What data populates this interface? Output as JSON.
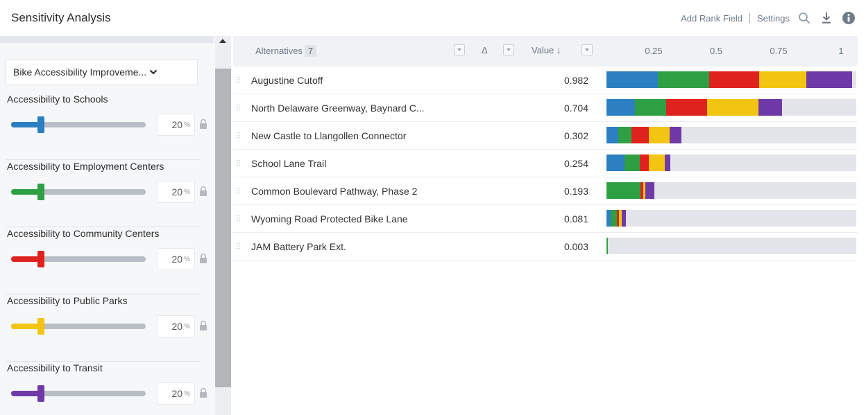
{
  "header": {
    "title": "Sensitivity Analysis",
    "add_rank_field": "Add Rank Field",
    "settings": "Settings",
    "icons": [
      "search-icon",
      "download-icon",
      "info-icon"
    ]
  },
  "sidebar": {
    "goal_dropdown": "Bike Accessibility Improveme...",
    "unit": "%",
    "criteria": [
      {
        "label": "Accessibility to Schools",
        "percent": "20",
        "weight": 0.2,
        "color": "#2c7fc0"
      },
      {
        "label": "Accessibility to Employment Centers",
        "percent": "20",
        "weight": 0.2,
        "color": "#2ea043"
      },
      {
        "label": "Accessibility to Community Centers",
        "percent": "20",
        "weight": 0.2,
        "color": "#e0221f"
      },
      {
        "label": "Accessibility to Public Parks",
        "percent": "20",
        "weight": 0.2,
        "color": "#f2c512"
      },
      {
        "label": "Accessibility to Transit",
        "percent": "20",
        "weight": 0.2,
        "color": "#6f3aa8"
      }
    ]
  },
  "table": {
    "col_alternatives": "Alternatives",
    "count": "7",
    "col_delta": "Δ",
    "col_value": "Value",
    "sort_indicator": "↓",
    "ticks": [
      "0.25",
      "0.5",
      "0.75",
      "1"
    ],
    "rows": [
      {
        "name": "Augustine Cutoff",
        "value": "0.982",
        "segments": [
          0.205,
          0.205,
          0.2,
          0.19,
          0.182
        ]
      },
      {
        "name": "North Delaware Greenway, Baynard C...",
        "value": "0.704",
        "segments": [
          0.115,
          0.125,
          0.165,
          0.205,
          0.094
        ]
      },
      {
        "name": "New Castle to Llangollen Connector",
        "value": "0.302",
        "segments": [
          0.048,
          0.053,
          0.07,
          0.084,
          0.047
        ]
      },
      {
        "name": "School Lane Trail",
        "value": "0.254",
        "segments": [
          0.072,
          0.062,
          0.035,
          0.063,
          0.022
        ]
      },
      {
        "name": "Common Boulevard Pathway, Phase 2",
        "value": "0.193",
        "segments": [
          0.0,
          0.135,
          0.012,
          0.009,
          0.037
        ]
      },
      {
        "name": "Wyoming Road Protected Bike Lane",
        "value": "0.081",
        "segments": [
          0.018,
          0.026,
          0.009,
          0.01,
          0.018
        ]
      },
      {
        "name": "JAM Battery Park Ext.",
        "value": "0.003",
        "segments": [
          0.0,
          0.003,
          0.0,
          0.0,
          0.0
        ]
      }
    ]
  }
}
